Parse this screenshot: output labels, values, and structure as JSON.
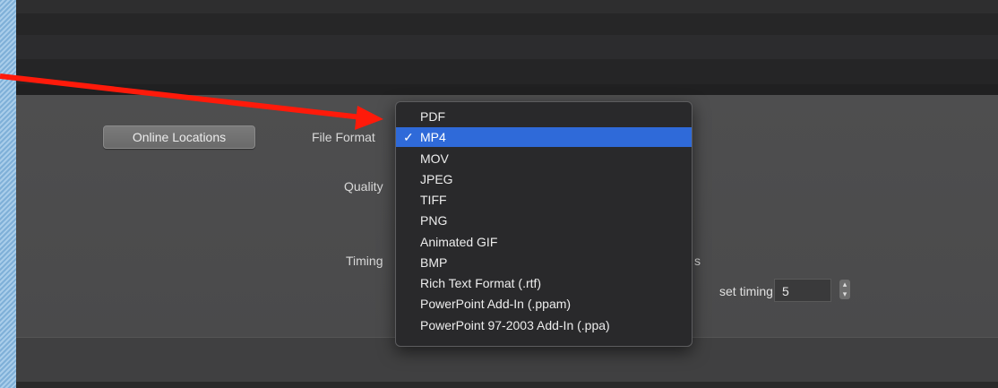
{
  "dialog": {
    "online_locations_label": "Online Locations",
    "file_format_label": "File Format",
    "quality_label": "Quality",
    "timing_label": "Timing",
    "partial_label_s": "s",
    "preset_timing_label": "set timing:",
    "timing_value": "5"
  },
  "format_menu": {
    "selected": "MP4",
    "items": [
      "PDF",
      "MP4",
      "MOV",
      "JPEG",
      "TIFF",
      "PNG",
      "Animated GIF",
      "BMP",
      "Rich Text Format (.rtf)",
      "PowerPoint Add-In (.ppam)",
      "PowerPoint 97-2003 Add-In (.ppa)"
    ]
  },
  "annotation": {
    "arrow_color": "#ff1a0a"
  },
  "colors": {
    "selection": "#2f6ad9"
  }
}
